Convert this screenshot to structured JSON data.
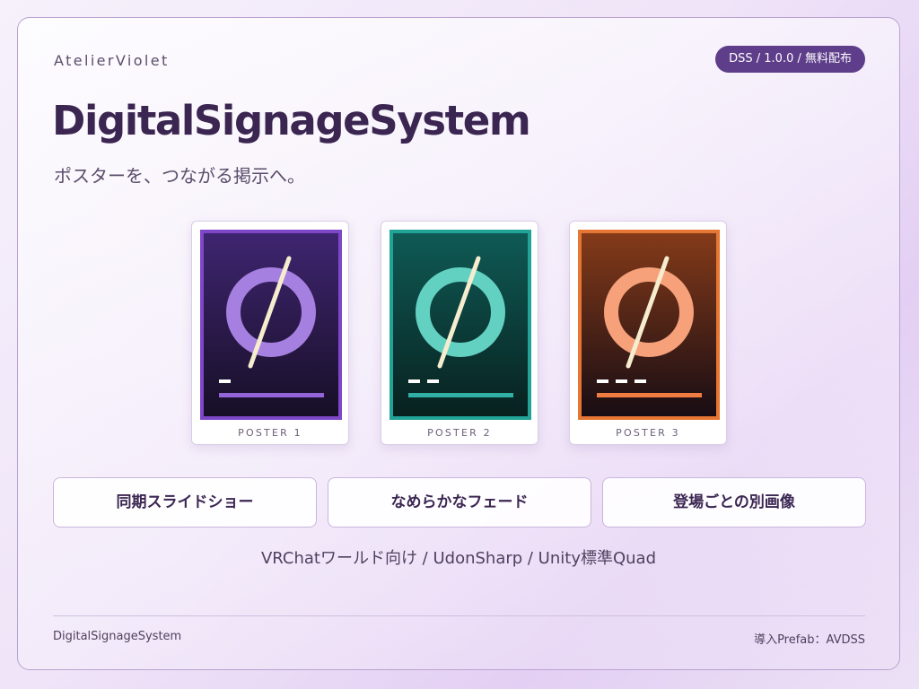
{
  "header": {
    "brand": "AtelierViolet",
    "version_badge": "DSS / 1.0.0 / 無料配布",
    "title": "DigitalSignageSystem",
    "tagline": "ポスターを、つながる掲示へ。"
  },
  "posters": [
    {
      "label": "POSTER 1",
      "dash_count": 1,
      "colors": {
        "frame": "#7d47c8",
        "bg_top": "#3f2570",
        "bg_bottom": "#170f27",
        "ring": "#a680e0",
        "bar": "#9264d8",
        "slash": "#f6edcf",
        "dash": "#ffffff"
      }
    },
    {
      "label": "POSTER 2",
      "dash_count": 2,
      "colors": {
        "frame": "#21a497",
        "bg_top": "#0f5a55",
        "bg_bottom": "#08211f",
        "ring": "#63d1c2",
        "bar": "#30b0a4",
        "slash": "#f6edcf",
        "dash": "#ffffff"
      }
    },
    {
      "label": "POSTER 3",
      "dash_count": 3,
      "colors": {
        "frame": "#e67633",
        "bg_top": "#843a19",
        "bg_bottom": "#180d14",
        "ring": "#f6a17a",
        "bar": "#f07c42",
        "slash": "#f6edcf",
        "dash": "#ffffff"
      }
    }
  ],
  "features": [
    {
      "label": "同期スライドショー"
    },
    {
      "label": "なめらかなフェード"
    },
    {
      "label": "登場ごとの別画像"
    }
  ],
  "platform_line": "VRChatワールド向け / UdonSharp / Unity標準Quad",
  "footer": {
    "left": "DigitalSignageSystem",
    "right": "導入Prefab：AVDSS"
  },
  "theme": {
    "accent": "#5e3d8a",
    "title_color": "#3b2652"
  }
}
